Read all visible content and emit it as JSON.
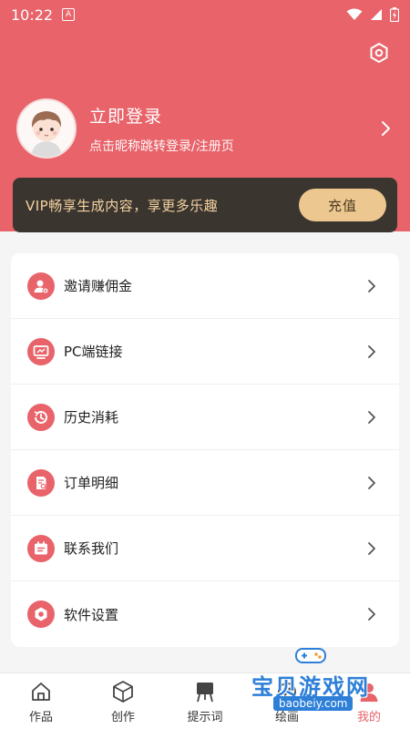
{
  "status_bar": {
    "time": "10:22",
    "notification_glyph": "A",
    "icons": [
      "wifi-icon",
      "signal-icon",
      "battery-icon"
    ]
  },
  "colors": {
    "brand": "#e8636a",
    "vip_bg": "#3b3530",
    "vip_text": "#f4d3a0",
    "vip_button": "#ecc78f"
  },
  "profile": {
    "title": "立即登录",
    "subtitle": "点击昵称跳转登录/注册页"
  },
  "vip": {
    "text": "VIP畅享生成内容，享更多乐趣",
    "button": "充值"
  },
  "menu": [
    {
      "label": "邀请赚佣金",
      "icon": "invite-user-icon"
    },
    {
      "label": "PC端链接",
      "icon": "monitor-icon"
    },
    {
      "label": "历史消耗",
      "icon": "history-icon"
    },
    {
      "label": "订单明细",
      "icon": "order-icon"
    },
    {
      "label": "联系我们",
      "icon": "contact-icon"
    },
    {
      "label": "软件设置",
      "icon": "settings-icon"
    }
  ],
  "bottom_nav": [
    {
      "label": "作品",
      "icon": "home-icon",
      "active": false
    },
    {
      "label": "创作",
      "icon": "cube-icon",
      "active": false
    },
    {
      "label": "提示词",
      "icon": "easel-icon",
      "active": false
    },
    {
      "label": "绘画",
      "icon": "paint-icon",
      "active": false
    },
    {
      "label": "我的",
      "icon": "profile-icon",
      "active": true
    }
  ],
  "watermark": {
    "title": "宝贝游戏网",
    "url": "baobeiy.com"
  }
}
